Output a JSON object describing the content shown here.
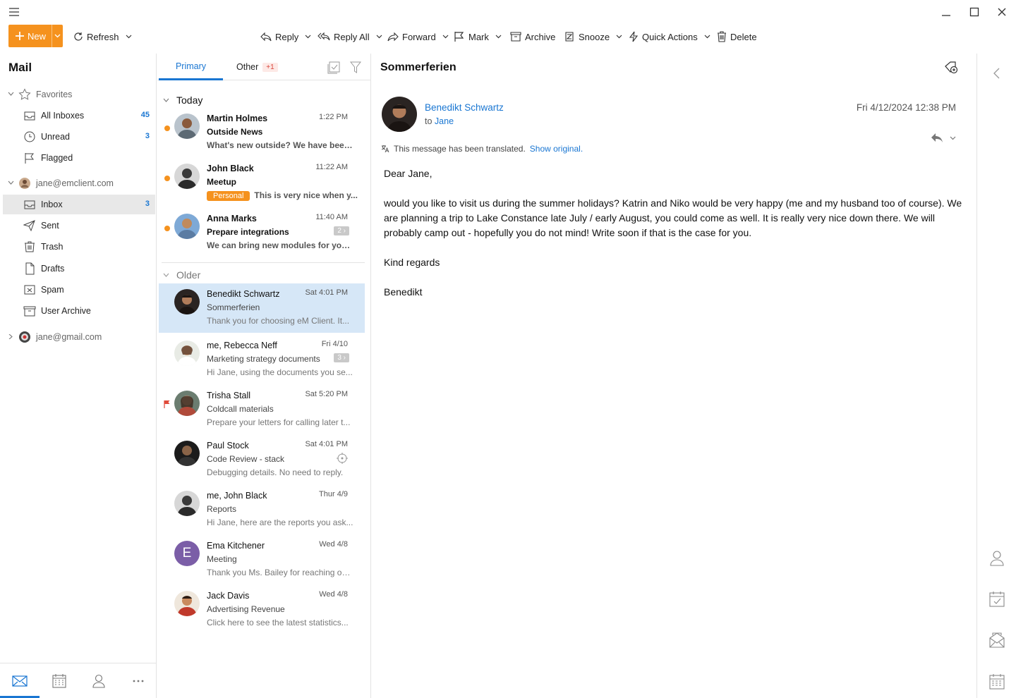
{
  "toolbar": {
    "new_label": "New",
    "refresh_label": "Refresh",
    "reply_label": "Reply",
    "reply_all_label": "Reply All",
    "forward_label": "Forward",
    "mark_label": "Mark",
    "archive_label": "Archive",
    "snooze_label": "Snooze",
    "quick_actions_label": "Quick Actions",
    "delete_label": "Delete"
  },
  "sidebar": {
    "title": "Mail",
    "favorites_label": "Favorites",
    "all_inboxes_label": "All Inboxes",
    "all_inboxes_count": "45",
    "unread_label": "Unread",
    "unread_count": "3",
    "flagged_label": "Flagged",
    "account1": "jane@emclient.com",
    "inbox_label": "Inbox",
    "inbox_count": "3",
    "sent_label": "Sent",
    "trash_label": "Trash",
    "drafts_label": "Drafts",
    "spam_label": "Spam",
    "user_archive_label": "User Archive",
    "account2": "jane@gmail.com"
  },
  "list": {
    "tab_primary": "Primary",
    "tab_other": "Other",
    "tab_other_badge": "+1",
    "section_today": "Today",
    "section_older": "Older",
    "messages": [
      {
        "from": "Martin Holmes",
        "time": "1:22 PM",
        "subject": "Outside News",
        "preview": "What's new outside? We have been..."
      },
      {
        "from": "John Black",
        "time": "11:22 AM",
        "subject": "Meetup",
        "tag": "Personal",
        "preview": "This is very nice when y..."
      },
      {
        "from": "Anna Marks",
        "time": "11:40 AM",
        "subject": "Prepare integrations",
        "thread": "2",
        "preview": "We can bring new modules for you..."
      },
      {
        "from": "Benedikt Schwartz",
        "time": "Sat 4:01 PM",
        "subject": "Sommerferien",
        "preview": "Thank you for choosing eM Client. It..."
      },
      {
        "from": "me, Rebecca Neff",
        "time": "Fri 4/10",
        "subject": "Marketing strategy documents",
        "thread": "3",
        "preview": "Hi Jane, using the documents you se..."
      },
      {
        "from": "Trisha Stall",
        "time": "Sat 5:20 PM",
        "subject": "Coldcall materials",
        "preview": "Prepare your letters for calling later t..."
      },
      {
        "from": "Paul Stock",
        "time": "Sat 4:01 PM",
        "subject": "Code Review - stack",
        "preview": "Debugging details. No need to reply."
      },
      {
        "from": "me, John Black",
        "time": "Thur 4/9",
        "subject": "Reports",
        "preview": "Hi Jane, here are the reports you ask..."
      },
      {
        "from": "Ema Kitchener",
        "time": "Wed 4/8",
        "subject": "Meeting",
        "preview": "Thank you Ms. Bailey for reaching ou...",
        "initial": "E"
      },
      {
        "from": "Jack Davis",
        "time": "Wed 4/8",
        "subject": "Advertising Revenue",
        "preview": "Click here to see the latest statistics..."
      }
    ]
  },
  "reader": {
    "subject": "Sommerferien",
    "sender": "Benedikt Schwartz",
    "to_prefix": "to",
    "to_name": "Jane",
    "date": "Fri 4/12/2024 12:38 PM",
    "translated_text": "This message has been translated.",
    "show_original": "Show original.",
    "body": [
      "Dear Jane,",
      "would you like to visit us during the summer holidays? Katrin and Niko would be very happy (me and my husband too of course). We are planning a trip to Lake Constance late July / early August, you could come as well. It is really very nice down there. We will probably camp out - hopefully you do not mind! Write soon if that is the case for you.",
      "Kind regards",
      "Benedikt"
    ]
  },
  "colors": {
    "accent": "#1976d2",
    "new_button": "#f5921e",
    "unread_dot": "#f5921e",
    "selected_row": "#d6e7f7"
  }
}
